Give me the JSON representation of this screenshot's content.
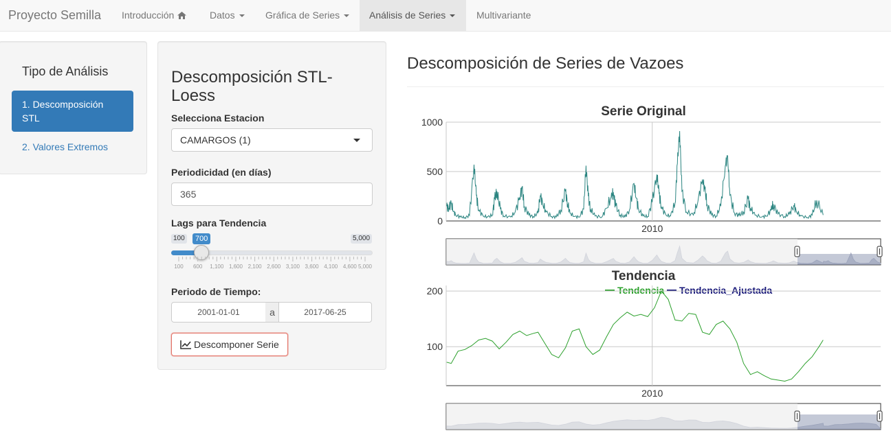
{
  "navbar": {
    "brand": "Proyecto Semilla",
    "items": [
      {
        "label": "Introducción"
      },
      {
        "label": "Datos"
      },
      {
        "label": "Gráfica de Series"
      },
      {
        "label": "Análisis de Series"
      },
      {
        "label": "Multivariante"
      }
    ]
  },
  "sidebar": {
    "title": "Tipo de Análisis",
    "items": [
      {
        "label": "1. Descomposición STL"
      },
      {
        "label": "2. Valores Extremos"
      }
    ]
  },
  "form": {
    "title": "Descomposición STL-Loess",
    "station_label": "Selecciona Estacion",
    "station_value": "CAMARGOS (1)",
    "period_label": "Periodicidad (en días)",
    "period_value": "365",
    "lags_label": "Lags para Tendencia",
    "slider": {
      "min_label": "100",
      "max_label": "5,000",
      "value_label": "700",
      "min": 100,
      "max": 5000,
      "value": 700,
      "ticks": [
        "100",
        "600",
        "1,100",
        "1,600",
        "2,100",
        "2,600",
        "3,100",
        "3,600",
        "4,100",
        "4,600",
        "5,000"
      ]
    },
    "date_label": "Periodo de Tiempo:",
    "date_start": "2001-01-01",
    "date_sep": "a",
    "date_end": "2017-06-25",
    "button_label": "Descomponer Serie"
  },
  "main": {
    "title": "Descomposición de Series de Vazoes"
  },
  "colors": {
    "original": "#2a8480",
    "tendencia": "#2ca02c",
    "ajustada": "#1a1a7a",
    "primary": "#337ab7"
  },
  "chart_data": [
    {
      "type": "line",
      "title": "Serie Original",
      "x_tick_labels": [
        "2010"
      ],
      "y_tick_labels": [
        "1000",
        "500",
        "0"
      ],
      "ylim": [
        0,
        1000
      ],
      "grid": true,
      "series": [
        {
          "x": [
            2001.0,
            2001.1,
            2001.2,
            2001.3,
            2001.4,
            2001.6,
            2001.8,
            2002.0,
            2002.2,
            2002.3,
            2002.4,
            2002.6,
            2002.8,
            2003.0,
            2003.1,
            2003.2,
            2003.35,
            2003.5,
            2003.8,
            2004.0,
            2004.2,
            2004.3,
            2004.4,
            2004.6,
            2004.8,
            2005.0,
            2005.1,
            2005.2,
            2005.35,
            2005.6,
            2005.8,
            2006.0,
            2006.2,
            2006.3,
            2006.4,
            2006.6,
            2006.8,
            2007.0,
            2007.1,
            2007.2,
            2007.3,
            2007.5,
            2007.8,
            2008.0,
            2008.2,
            2008.3,
            2008.4,
            2008.6,
            2008.8,
            2009.0,
            2009.2,
            2009.3,
            2009.4,
            2009.6,
            2009.8,
            2010.0,
            2010.2,
            2010.3,
            2010.4,
            2010.6,
            2010.8,
            2011.0,
            2011.1,
            2011.2,
            2011.3,
            2011.5,
            2011.8,
            2012.0,
            2012.2,
            2012.3,
            2012.4,
            2012.6,
            2012.8,
            2013.0,
            2013.2,
            2013.3,
            2013.4,
            2013.6,
            2013.8,
            2014.0,
            2014.2,
            2014.3,
            2014.5,
            2014.8,
            2015.0,
            2015.2,
            2015.3,
            2015.5,
            2015.8,
            2016.0,
            2016.2,
            2016.3,
            2016.5,
            2016.8,
            2017.0,
            2017.2,
            2017.48
          ],
          "y": [
            150,
            130,
            180,
            95,
            60,
            40,
            35,
            55,
            570,
            260,
            110,
            50,
            40,
            60,
            220,
            300,
            120,
            50,
            40,
            90,
            240,
            330,
            150,
            60,
            45,
            80,
            260,
            180,
            90,
            45,
            40,
            110,
            300,
            170,
            80,
            45,
            40,
            120,
            560,
            250,
            120,
            50,
            40,
            130,
            240,
            290,
            150,
            60,
            40,
            110,
            380,
            230,
            120,
            50,
            45,
            190,
            470,
            280,
            140,
            60,
            50,
            180,
            580,
            910,
            300,
            90,
            60,
            200,
            420,
            320,
            170,
            60,
            50,
            150,
            560,
            660,
            260,
            80,
            55,
            90,
            220,
            130,
            60,
            40,
            50,
            110,
            170,
            70,
            45,
            70,
            160,
            100,
            50,
            35,
            60,
            210,
            60
          ]
        }
      ]
    },
    {
      "type": "line",
      "title": "Tendencia",
      "x_tick_labels": [
        "2010"
      ],
      "y_tick_labels": [
        "200",
        "100"
      ],
      "ylim": [
        30,
        210
      ],
      "grid": true,
      "legend": "top-center",
      "series": [
        {
          "name": "Tendencia",
          "x": [
            2001.0,
            2001.2,
            2001.5,
            2001.8,
            2002.1,
            2002.4,
            2002.7,
            2003.0,
            2003.3,
            2003.6,
            2003.9,
            2004.2,
            2004.5,
            2004.8,
            2005.0,
            2005.3,
            2005.6,
            2005.9,
            2006.2,
            2006.5,
            2006.8,
            2007.1,
            2007.4,
            2007.7,
            2008.0,
            2008.3,
            2008.6,
            2008.9,
            2009.2,
            2009.5,
            2009.8,
            2010.1,
            2010.4,
            2010.7,
            2011.0,
            2011.3,
            2011.6,
            2011.9,
            2012.2,
            2012.5,
            2012.8,
            2013.1,
            2013.4,
            2013.7,
            2014.0,
            2014.3,
            2014.6,
            2014.9,
            2015.2,
            2015.5,
            2015.8,
            2016.1,
            2016.4,
            2016.7,
            2017.0,
            2017.3,
            2017.48
          ],
          "y": [
            72,
            70,
            92,
            95,
            102,
            112,
            115,
            110,
            96,
            108,
            122,
            128,
            120,
            124,
            126,
            106,
            86,
            80,
            98,
            128,
            132,
            100,
            86,
            94,
            118,
            140,
            152,
            162,
            155,
            158,
            154,
            170,
            200,
            185,
            148,
            146,
            160,
            158,
            126,
            122,
            140,
            146,
            132,
            108,
            70,
            50,
            55,
            48,
            42,
            40,
            38,
            42,
            55,
            70,
            82,
            100,
            112
          ]
        },
        {
          "name": "Tendencia_Ajustada",
          "x": [],
          "y": []
        }
      ]
    }
  ]
}
